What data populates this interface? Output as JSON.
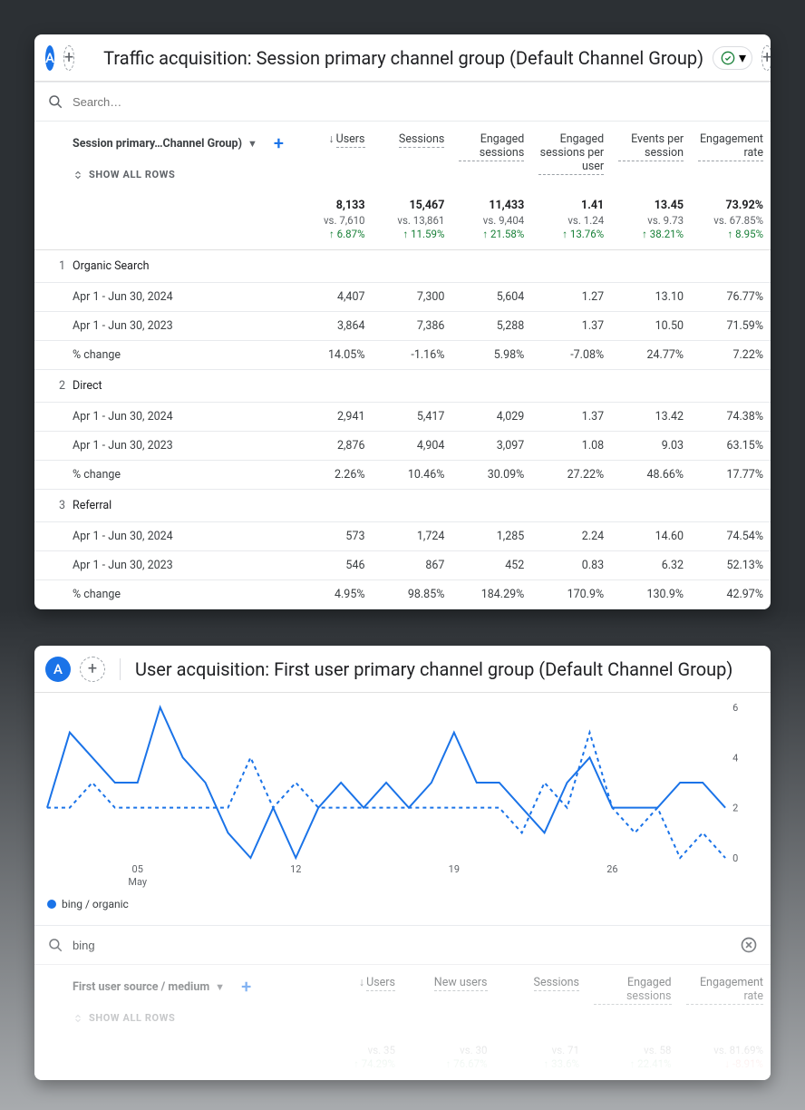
{
  "card1": {
    "avatar": "A",
    "title": "Traffic acquisition: Session primary channel group (Default Channel Group)",
    "search_placeholder": "Search…",
    "dim_label": "Session primary…Channel Group)",
    "show_all": "SHOW ALL ROWS",
    "metrics": [
      "Users",
      "Sessions",
      "Engaged sessions",
      "Engaged sessions per user",
      "Events per session",
      "Engagement rate"
    ],
    "totals": {
      "Users": {
        "val": "8,133",
        "vs": "vs. 7,610",
        "delta": "↑ 6.87%",
        "dir": "up"
      },
      "Sessions": {
        "val": "15,467",
        "vs": "vs. 13,861",
        "delta": "↑ 11.59%",
        "dir": "up"
      },
      "Engaged sessions": {
        "val": "11,433",
        "vs": "vs. 9,404",
        "delta": "↑ 21.58%",
        "dir": "up"
      },
      "Engaged sessions per user": {
        "val": "1.41",
        "vs": "vs. 1.24",
        "delta": "↑ 13.76%",
        "dir": "up"
      },
      "Events per session": {
        "val": "13.45",
        "vs": "vs. 9.73",
        "delta": "↑ 38.21%",
        "dir": "up"
      },
      "Engagement rate": {
        "val": "73.92%",
        "vs": "vs. 67.85%",
        "delta": "↑ 8.95%",
        "dir": "up"
      }
    },
    "groups": [
      {
        "idx": "1",
        "name": "Organic Search",
        "rows": [
          {
            "label": "Apr 1 - Jun 30, 2024",
            "v": [
              "4,407",
              "7,300",
              "5,604",
              "1.27",
              "13.10",
              "76.77%"
            ]
          },
          {
            "label": "Apr 1 - Jun 30, 2023",
            "v": [
              "3,864",
              "7,386",
              "5,288",
              "1.37",
              "10.50",
              "71.59%"
            ]
          },
          {
            "label": "% change",
            "v": [
              "14.05%",
              "-1.16%",
              "5.98%",
              "-7.08%",
              "24.77%",
              "7.22%"
            ]
          }
        ]
      },
      {
        "idx": "2",
        "name": "Direct",
        "rows": [
          {
            "label": "Apr 1 - Jun 30, 2024",
            "v": [
              "2,941",
              "5,417",
              "4,029",
              "1.37",
              "13.42",
              "74.38%"
            ]
          },
          {
            "label": "Apr 1 - Jun 30, 2023",
            "v": [
              "2,876",
              "4,904",
              "3,097",
              "1.08",
              "9.03",
              "63.15%"
            ]
          },
          {
            "label": "% change",
            "v": [
              "2.26%",
              "10.46%",
              "30.09%",
              "27.22%",
              "48.66%",
              "17.77%"
            ]
          }
        ]
      },
      {
        "idx": "3",
        "name": "Referral",
        "rows": [
          {
            "label": "Apr 1 - Jun 30, 2024",
            "v": [
              "573",
              "1,724",
              "1,285",
              "2.24",
              "14.60",
              "74.54%"
            ]
          },
          {
            "label": "Apr 1 - Jun 30, 2023",
            "v": [
              "546",
              "867",
              "452",
              "0.83",
              "6.32",
              "52.13%"
            ]
          },
          {
            "label": "% change",
            "v": [
              "4.95%",
              "98.85%",
              "184.29%",
              "170.9%",
              "130.9%",
              "42.97%"
            ]
          }
        ]
      }
    ]
  },
  "card2": {
    "avatar": "A",
    "title": "User acquisition: First user primary channel group (Default Channel Group)",
    "search_value": "bing",
    "dim_label": "First user source / medium",
    "show_all": "SHOW ALL ROWS",
    "legend": "bing / organic",
    "metrics": [
      "Users",
      "New users",
      "Sessions",
      "Engaged sessions",
      "Engagement rate"
    ],
    "totals": {
      "Users": {
        "vs": "vs. 35",
        "delta": "↑ 74.29%",
        "dir": "up"
      },
      "New users": {
        "vs": "vs. 30",
        "delta": "↑ 76.67%",
        "dir": "up"
      },
      "Sessions": {
        "vs": "vs. 71",
        "delta": "↑ 33.6%",
        "dir": "up"
      },
      "Engaged sessions": {
        "vs": "vs. 58",
        "delta": "↑ 22.41%",
        "dir": "up"
      },
      "Engagement rate": {
        "vs": "vs. 81.69%",
        "delta": "↓ -8.91%",
        "dir": "down"
      }
    }
  },
  "chart_data": {
    "type": "line",
    "title": "",
    "xlabel": "May",
    "ylabel": "",
    "x_ticks": [
      "05",
      "12",
      "19",
      "26"
    ],
    "ylim": [
      0,
      6
    ],
    "x": [
      1,
      2,
      3,
      4,
      5,
      6,
      7,
      8,
      9,
      10,
      11,
      12,
      13,
      14,
      15,
      16,
      17,
      18,
      19,
      20,
      21,
      22,
      23,
      24,
      25,
      26,
      27,
      28,
      29,
      30,
      31
    ],
    "series": [
      {
        "name": "bing / organic (2024)",
        "style": "solid",
        "values": [
          2,
          5,
          4,
          3,
          3,
          6,
          4,
          3,
          1,
          0,
          2,
          0,
          2,
          3,
          2,
          3,
          2,
          3,
          5,
          3,
          3,
          2,
          1,
          3,
          4,
          2,
          2,
          2,
          3,
          3,
          2
        ]
      },
      {
        "name": "bing / organic (2023)",
        "style": "dashed",
        "values": [
          2,
          2,
          3,
          2,
          2,
          2,
          2,
          2,
          2,
          4,
          2,
          3,
          2,
          2,
          2,
          2,
          2,
          2,
          2,
          2,
          2,
          1,
          3,
          2,
          5,
          2,
          1,
          2,
          0,
          1,
          0
        ]
      }
    ]
  }
}
